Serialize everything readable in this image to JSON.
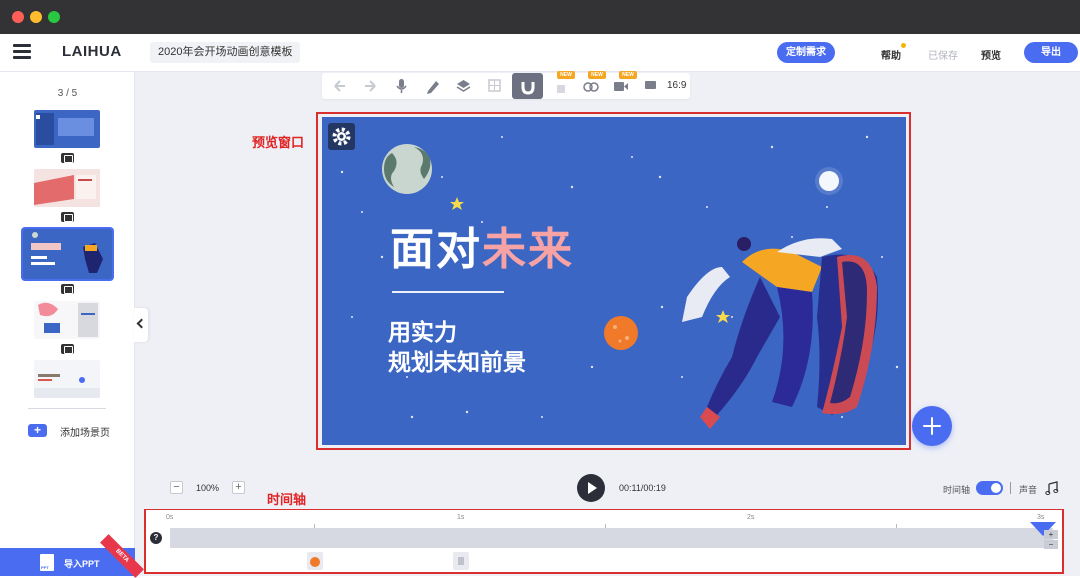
{
  "window": {
    "traffic_lights": [
      "#ff5f57",
      "#febc2e",
      "#28c840"
    ]
  },
  "topbar": {
    "logo": "LAIHUA",
    "doc_title": "2020年会开场动画创意模板",
    "custom_label": "定制需求",
    "help_label": "帮助",
    "saved_label": "已保存",
    "preview_label": "预览",
    "export_label": "导出"
  },
  "sidebar": {
    "page_count": "3 / 5",
    "add_scene_label": "添加场景页",
    "import_ppt_label": "导入PPT",
    "import_ppt_badge": "BETA",
    "import_ppt_icon_text": "PPT",
    "scenes": [
      {
        "thumb_text": "不忘初心 方得"
      },
      {
        "thumb_text": ""
      },
      {
        "thumb_text": "面对未来 用实力 规划未知前景",
        "selected": true
      },
      {
        "thumb_text": "拥抱 未来 机遇"
      },
      {
        "thumb_text": "雪地 以梦为马"
      }
    ]
  },
  "toolbar": {
    "ratio": "16:9",
    "new_badge": "NEW",
    "selected_tool": "magnet-icon"
  },
  "annotations": {
    "preview_window": "预览窗口",
    "timeline": "时间轴"
  },
  "stage": {
    "headline_part1": "面对",
    "headline_part2": "未来",
    "line1": "用实力",
    "line2": "规划未知前景",
    "bg_color": "#3b66c4"
  },
  "playback": {
    "zoom": "100%",
    "zoom_minus": "−",
    "zoom_plus": "+",
    "time": "00:11/00:19",
    "timeline_toggle_label": "时间轴",
    "timeline_toggle_on": true,
    "sound_label": "声音"
  },
  "timeline": {
    "ticks": [
      "0s",
      "1s",
      "2s",
      "3s"
    ],
    "help": "?",
    "zoom_in": "+",
    "zoom_out": "−"
  },
  "colors": {
    "accent": "#4a6cf0",
    "annotation_red": "#d9302f",
    "headline_pink": "#f7a3a5"
  }
}
